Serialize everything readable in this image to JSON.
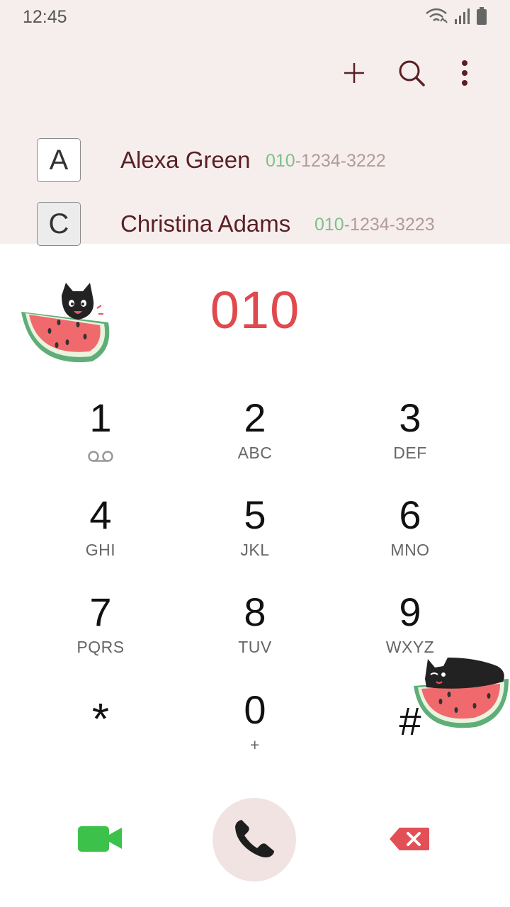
{
  "status_bar": {
    "time": "12:45",
    "icons": [
      "wifi-icon",
      "signal-icon",
      "battery-icon"
    ]
  },
  "toolbar": {
    "icons": [
      "add-icon",
      "search-icon",
      "more-options-icon"
    ]
  },
  "contacts": [
    {
      "index": "A",
      "name": "Alexa Green",
      "number_match": "010",
      "number_rest": "-1234-3222"
    },
    {
      "index": "C",
      "name": "Christina Adams",
      "number_match": "010",
      "number_rest": "-1234-3223"
    }
  ],
  "dial": {
    "entered": "010"
  },
  "keypad": [
    {
      "digit": "1",
      "letters": ""
    },
    {
      "digit": "2",
      "letters": "ABC"
    },
    {
      "digit": "3",
      "letters": "DEF"
    },
    {
      "digit": "4",
      "letters": "GHI"
    },
    {
      "digit": "5",
      "letters": "JKL"
    },
    {
      "digit": "6",
      "letters": "MNO"
    },
    {
      "digit": "7",
      "letters": "PQRS"
    },
    {
      "digit": "8",
      "letters": "TUV"
    },
    {
      "digit": "9",
      "letters": "WXYZ"
    },
    {
      "digit": "*",
      "letters": ""
    },
    {
      "digit": "0",
      "letters": "+"
    },
    {
      "digit": "#",
      "letters": ""
    }
  ],
  "colors": {
    "accent_red": "#e0494d",
    "match_green": "#7cc08a",
    "video_green": "#3cc24a",
    "delete_red": "#e25056",
    "header_bg": "#f6eeed"
  }
}
